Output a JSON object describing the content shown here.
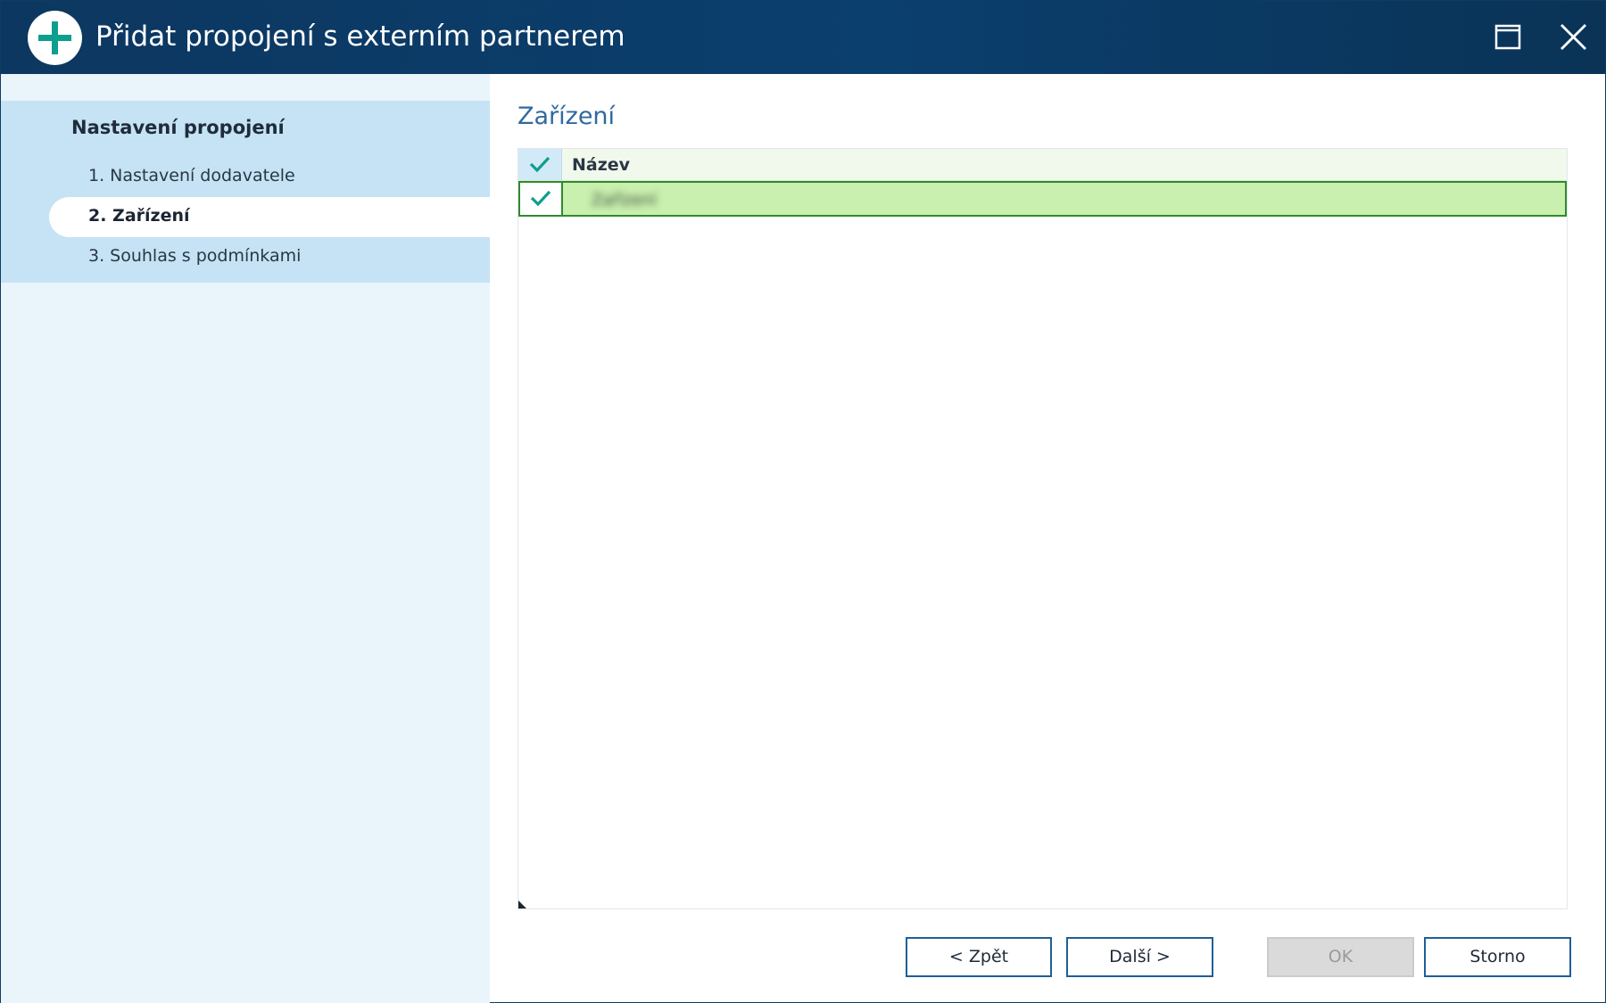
{
  "window": {
    "title": "Přidat propojení s externím partnerem",
    "app_icon": "plus-circle-icon",
    "controls": [
      "maximize-icon",
      "close-icon"
    ]
  },
  "sidebar": {
    "heading": "Nastavení propojení",
    "steps": [
      {
        "label": "1. Nastavení dodavatele",
        "active": false
      },
      {
        "label": "2. Zařízení",
        "active": true
      },
      {
        "label": "3. Souhlas s podmínkami",
        "active": false
      }
    ]
  },
  "main": {
    "section_title": "Zařízení",
    "grid": {
      "columns": [
        "Název"
      ],
      "header_check_icon": "checkmark-icon",
      "rows": [
        {
          "checked": true,
          "name": "Zařízení"
        }
      ]
    }
  },
  "buttons": {
    "back": "< Zpět",
    "next": "Další >",
    "ok": "OK",
    "cancel": "Storno",
    "ok_enabled": false
  },
  "colors": {
    "titlebar": "#0c3760",
    "accent_teal": "#0e9e8e",
    "sidebar_band": "#c5e3f4",
    "sidebar_bg": "#e9f4fb",
    "selected_row": "#c9f0ae",
    "selected_row_border": "#2e8b2e",
    "section_title": "#2f6a9e"
  }
}
